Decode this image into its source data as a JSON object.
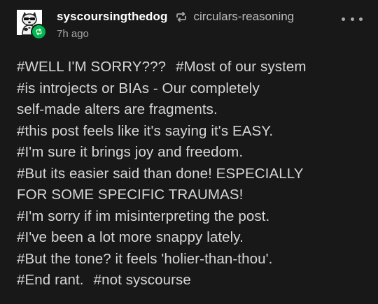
{
  "post": {
    "author": "syscoursingthedog",
    "source": "circulars-reasoning",
    "timestamp": "7h ago",
    "icons": {
      "avatar": "dog-avatar",
      "badge": "reblog-badge-icon",
      "reblog": "reblog-icon",
      "more": "more-options-icon"
    },
    "colors": {
      "background": "#181818",
      "badge": "#00b84d",
      "tag_text": "#d6d6d6"
    }
  },
  "tags": {
    "t0": "#WELL I'M SORRY???",
    "t1": "#Most of our system",
    "t2": "#is introjects or BIAs - Our completely",
    "t2b": "self-made alters are fragments.",
    "t3": "#this post feels like it's saying it's EASY.",
    "t4": "#I'm sure it brings joy and freedom.",
    "t5": "#But its easier said than done! ESPECIALLY",
    "t5b": "FOR SOME SPECIFIC TRAUMAS!",
    "t6": "#I'm sorry if im misinterpreting the post.",
    "t7": "#I've been a lot more snappy lately.",
    "t8": "#But the tone? it feels 'holier-than-thou'.",
    "t9": "#End rant.",
    "t10": "#not syscourse"
  }
}
